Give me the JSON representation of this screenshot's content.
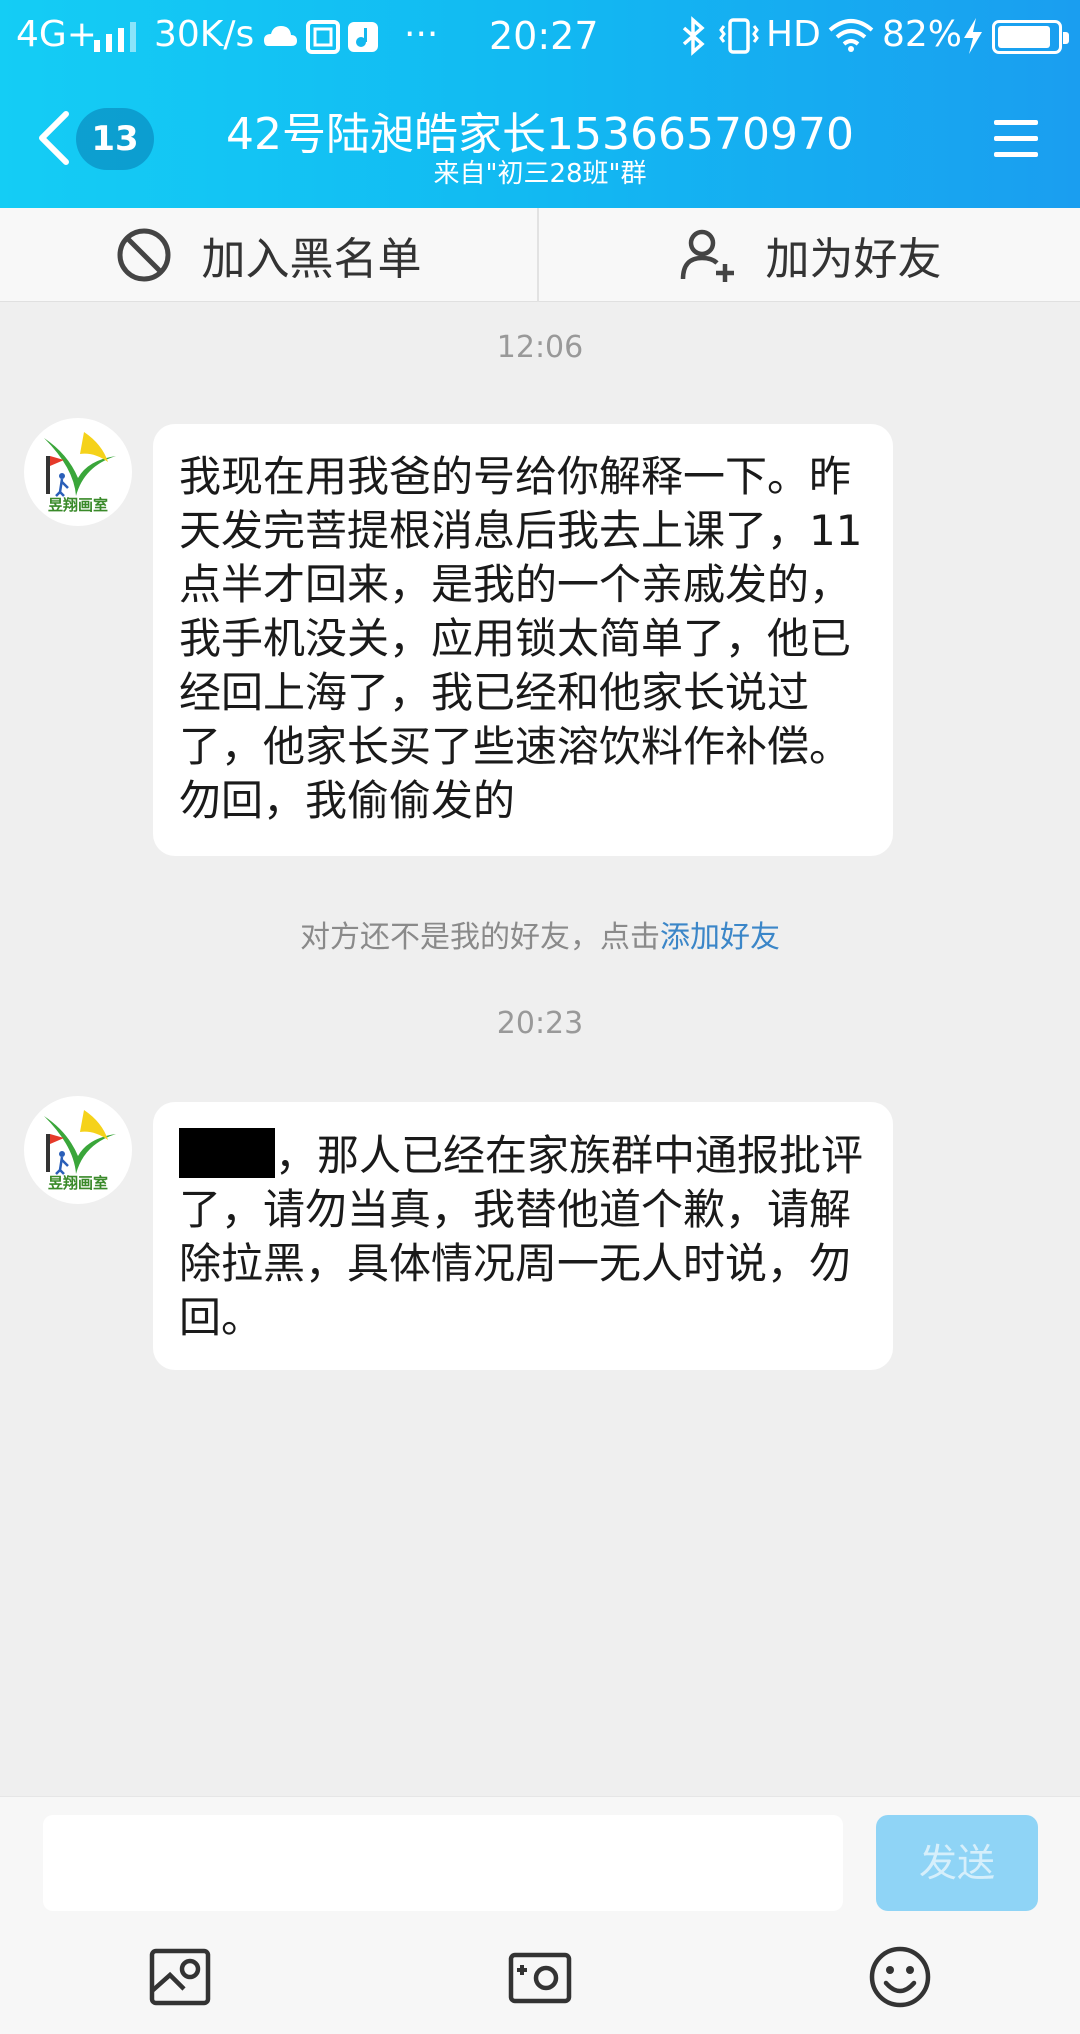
{
  "status_bar": {
    "network": "4G+",
    "speed": "30K/s",
    "dots": "···",
    "time": "20:27",
    "hd": "HD",
    "battery": "82%"
  },
  "header": {
    "back_badge": "13",
    "title": "42号陆昶皓家长15366570970",
    "subtitle": "来自\"初三28班\"群"
  },
  "actions": {
    "block_label": "加入黑名单",
    "add_friend_label": "加为好友"
  },
  "chat": {
    "timestamp_1": "12:06",
    "message_1": "我现在用我爸的号给你解释一下。昨天发完菩提根消息后我去上课了，11点半才回来，是我的一个亲戚发的，我手机没关，应用锁太简单了，他已经回上海了，我已经和他家长说过了，他家长买了些速溶饮料作补偿。勿回，我偷偷发的",
    "notice_text": "对方还不是我的好友，点击",
    "notice_link": "添加好友",
    "timestamp_2": "20:23",
    "message_2": "，那人已经在家族群中通报批评了，请勿当真，我替他道个歉，请解除拉黑，具体情况周一无人时说，勿回。",
    "avatar_label": "昱翔画室"
  },
  "input": {
    "send_label": "发送"
  },
  "colors": {
    "header_start": "#14cdf5",
    "header_end": "#1a9ef0",
    "link": "#3b86c8",
    "send_button": "#8fd4f6"
  },
  "icons": {
    "block": "block-icon",
    "add_friend": "add-friend-icon",
    "image": "image-icon",
    "camera": "camera-icon",
    "emoji": "emoji-icon"
  }
}
